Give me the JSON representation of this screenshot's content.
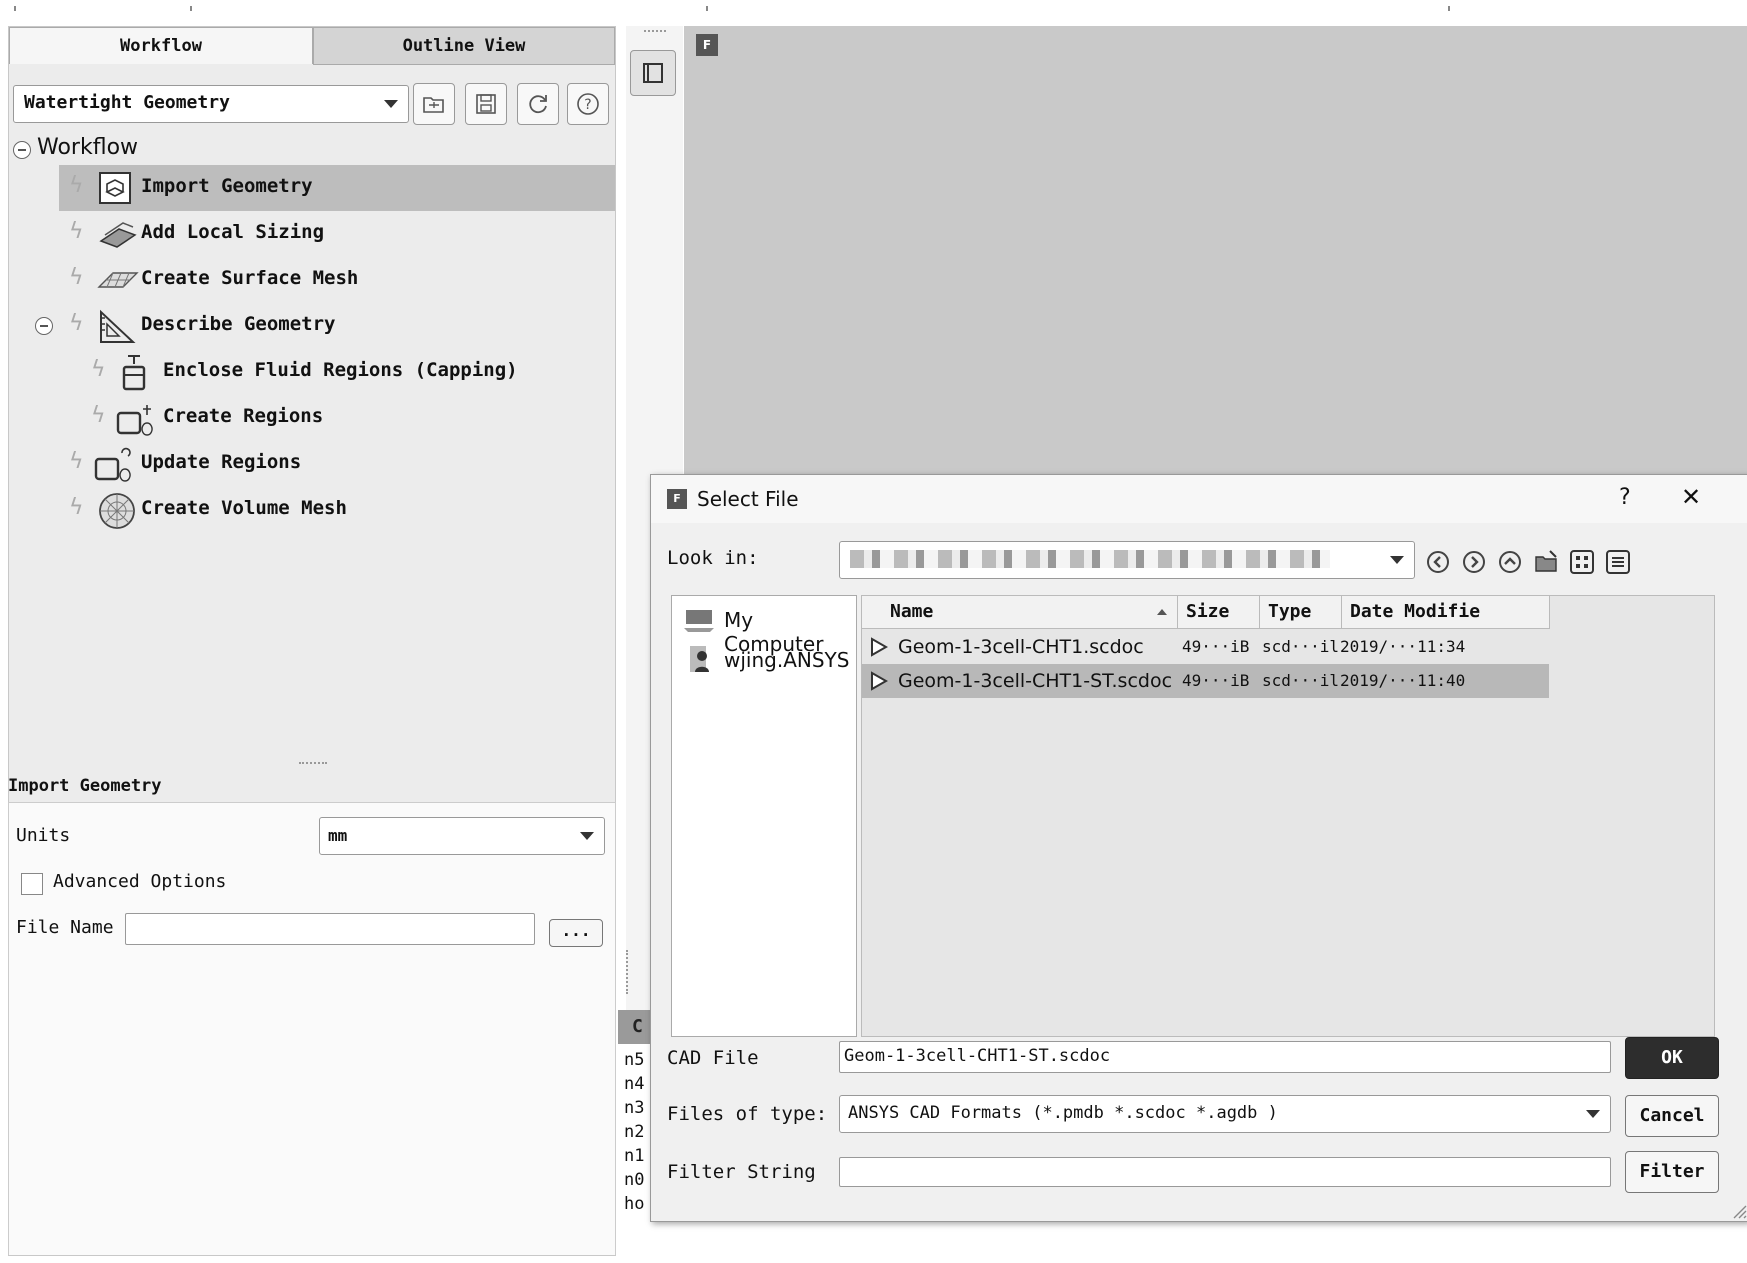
{
  "workflow_panel": {
    "tabs": [
      "Workflow",
      "Outline View"
    ],
    "workflow_type": "Watertight Geometry",
    "tree_root": "Workflow",
    "tasks": [
      "Import Geometry",
      "Add Local Sizing",
      "Create Surface Mesh",
      "Describe Geometry",
      "Enclose Fluid Regions (Capping)",
      "Create Regions",
      "Update Regions",
      "Create Volume Mesh"
    ]
  },
  "task_panel": {
    "title": "Import Geometry",
    "units_label": "Units",
    "units_value": "mm",
    "advanced_label": "Advanced Options",
    "advanced_checked": false,
    "file_name_label": "File Name",
    "file_name_value": "",
    "browse_label": "..."
  },
  "viewport": {
    "badge": "F"
  },
  "console": {
    "header": "C",
    "lines": [
      "n5",
      "n4",
      "n3",
      "n2",
      "n1",
      "n0",
      "ho"
    ]
  },
  "dialog": {
    "title": "Select File",
    "help": "?",
    "close": "✕",
    "look_in_label": "Look in:",
    "sidebar": [
      "My Computer",
      "wjing.ANSYS"
    ],
    "columns": [
      "Name",
      "Size",
      "Type",
      "Date Modifie"
    ],
    "files": [
      {
        "name": "Geom-1-3cell-CHT1.scdoc",
        "size": "49···iB",
        "type": "scd···il",
        "date": "2019/···11:34",
        "selected": false
      },
      {
        "name": "Geom-1-3cell-CHT1-ST.scdoc",
        "size": "49···iB",
        "type": "scd···il",
        "date": "2019/···11:40",
        "selected": true
      }
    ],
    "cad_file_label": "CAD File",
    "cad_file_value": "Geom-1-3cell-CHT1-ST.scdoc",
    "files_of_type_label": "Files of type:",
    "files_of_type_value": "ANSYS CAD Formats (*.pmdb *.scdoc *.agdb )",
    "filter_string_label": "Filter String",
    "filter_string_value": "",
    "ok_label": "OK",
    "cancel_label": "Cancel",
    "filter_label": "Filter"
  }
}
